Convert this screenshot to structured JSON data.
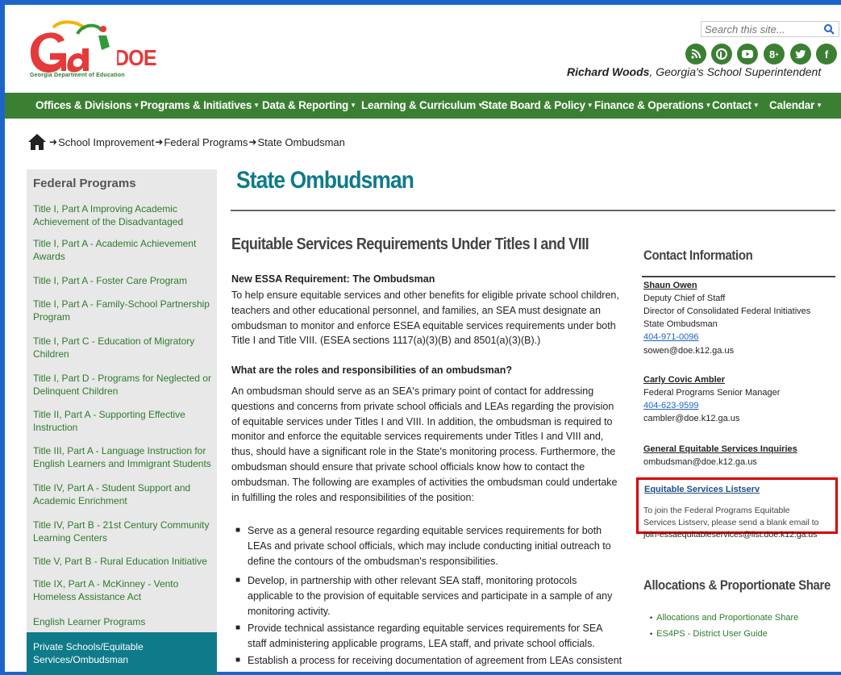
{
  "header": {
    "logo_text": "GaDOE",
    "logo_subtitle": "Georgia Department of Education",
    "search_placeholder": "Search this site...",
    "superintendent_name": "Richard Woods",
    "superintendent_title": ", Georgia's School Superintendent",
    "social_icons": [
      "rss-icon",
      "pinterest-icon",
      "youtube-icon",
      "google-plus-icon",
      "twitter-icon",
      "facebook-icon"
    ],
    "colors": {
      "brand_green": "#3b7f33",
      "teal": "#0f7a8a",
      "frame_blue": "#1e64c8",
      "highlight_red": "#d80000"
    }
  },
  "nav": {
    "items": [
      {
        "label": "Offices & Divisions"
      },
      {
        "label": "Programs & Initiatives"
      },
      {
        "label": "Data & Reporting"
      },
      {
        "label": "Learning & Curriculum"
      },
      {
        "label": "State Board & Policy"
      },
      {
        "label": "Finance & Operations"
      },
      {
        "label": "Contact"
      },
      {
        "label": "Calendar"
      }
    ]
  },
  "breadcrumb": {
    "items": [
      "School Improvement",
      "Federal Programs",
      "State Ombudsman"
    ]
  },
  "sidebar": {
    "title": "Federal Programs",
    "items": [
      "Title I, Part A Improving Academic Achievement of the Disadvantaged",
      "Title I, Part A - Academic Achievement Awards",
      "Title I, Part A - Foster Care Program",
      "Title I, Part A - Family-School Partnership Program",
      "Title I, Part C - Education of Migratory Children",
      "Title I, Part D - Programs for Neglected or Delinquent Children",
      "Title II, Part A - Supporting Effective Instruction",
      "Title III, Part A - Language Instruction for English Learners and Immigrant Students",
      "Title IV, Part A - Student Support and Academic Enrichment",
      "Title IV, Part B - 21st Century Community Learning Centers",
      "Title V, Part B - Rural Education Initiative",
      "Title IX, Part A - McKinney - Vento Homeless Assistance Act",
      "English Learner Programs",
      "Private Schools/Equitable Services/Ombudsman"
    ]
  },
  "main": {
    "title": "State Ombudsman",
    "heading": "Equitable Services Requirements Under Titles I and VIII",
    "subheading1": "New ESSA Requirement: The Ombudsman",
    "para1_lines": [
      "To help ensure equitable services and other benefits for eligible private school children,",
      "teachers and other educational personnel, and families, an SEA must designate an",
      "ombudsman to monitor and enforce ESEA equitable services requirements under both",
      "Title I and Title VIII. (ESEA sections 1117(a)(3)(B) and 8501(a)(3)(B).)"
    ],
    "subheading2": "What are the roles and responsibilities of an ombudsman?",
    "para2_lines": [
      "An ombudsman should serve as an SEA's primary point of contact for addressing",
      "questions and concerns from private school officials and LEAs regarding the provision",
      "of equitable services under Titles I and VIII. In addition, the ombudsman is required to",
      "monitor and enforce the equitable services requirements under Titles I and VIII and,",
      "thus, should have a significant role in the State's monitoring process. Furthermore, the",
      "ombudsman should ensure that private school officials know how to contact the",
      "ombudsman. The following are examples of activities the ombudsman could undertake",
      "in fulfilling the roles and responsibilities of the position:"
    ],
    "bullets": [
      [
        "Serve as a general resource regarding equitable services requirements for both",
        "LEAs and private school officials, which may include conducting initial outreach to",
        "define the contours of the ombudsman's responsibilities."
      ],
      [
        "Develop, in partnership with other relevant SEA staff, monitoring protocols",
        "applicable to the provision of equitable services and participate in a sample of any",
        "monitoring activity."
      ],
      [
        "Provide technical assistance regarding equitable services requirements for SEA",
        "staff administering applicable programs, LEA staff, and private school officials."
      ],
      [
        "Establish a process for receiving documentation of agreement from LEAs consistent"
      ]
    ]
  },
  "contact": {
    "heading": "Contact Information",
    "person1": {
      "name": "Shaun Owen",
      "lines": [
        "Deputy Chief of Staff",
        "Director of Consolidated Federal Initiatives",
        "State Ombudsman"
      ],
      "phone": "404-971-0096",
      "email": "sowen@doe.k12.ga.us"
    },
    "person2": {
      "name": "Carly Covic Ambler",
      "lines": [
        "Federal Programs Senior Manager"
      ],
      "phone": "404-623-9599",
      "email": "cambler@doe.k12.ga.us"
    },
    "general": {
      "title": "General Equitable Services Inquiries",
      "email": "ombudsman@doe.k12.ga.us"
    },
    "listserv": {
      "title": "Equitable Services Listserv",
      "lines": [
        "To join the Federal Programs Equitable",
        "Services Listserv, please send a blank email to",
        "join-essaequitableservices@list.doe.k12.ga.us"
      ]
    }
  },
  "allocations": {
    "heading": "Allocations & Proportionate Share",
    "links": [
      "Allocations and Proportionate Share",
      "ES4PS - District User Guide"
    ]
  }
}
